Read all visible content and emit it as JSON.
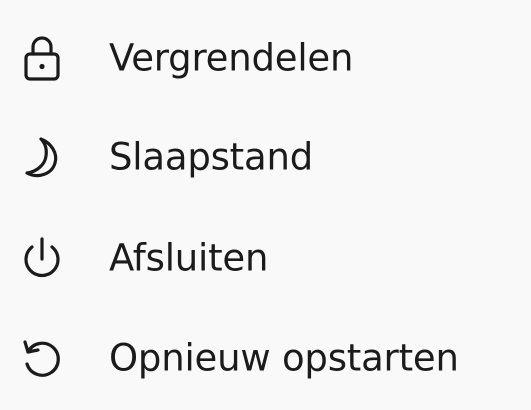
{
  "power_menu": {
    "items": [
      {
        "label": "Vergrendelen",
        "icon": "lock-icon"
      },
      {
        "label": "Slaapstand",
        "icon": "moon-icon"
      },
      {
        "label": "Afsluiten",
        "icon": "power-icon"
      },
      {
        "label": "Opnieuw opstarten",
        "icon": "restart-icon"
      }
    ]
  },
  "colors": {
    "background": "#f9f9f9",
    "text": "#1b1b1b",
    "icon_stroke": "#1b1b1b"
  }
}
